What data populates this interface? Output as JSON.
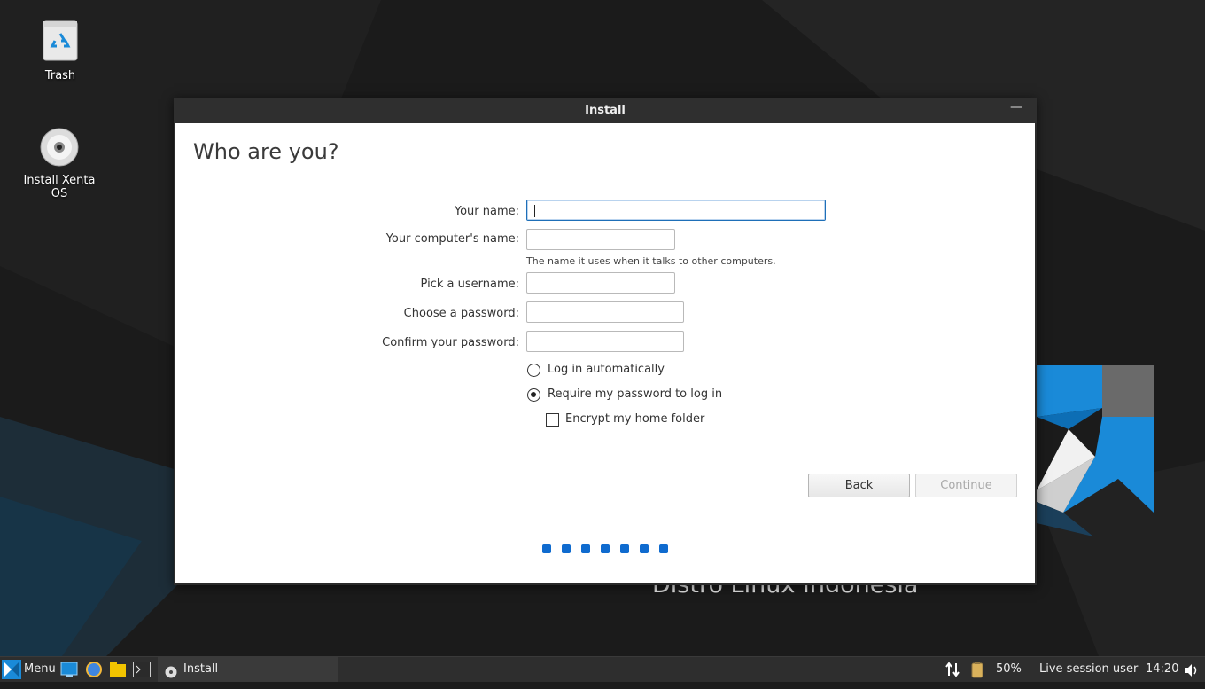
{
  "desktop": {
    "icons": [
      {
        "label": "Trash",
        "icon": "trash-icon"
      },
      {
        "label": "Install Xenta OS",
        "icon": "disc-icon"
      }
    ],
    "wallpaper_text": "Distro Linux Indonesia"
  },
  "window": {
    "title": "Install",
    "minimize_symbol": "—"
  },
  "page": {
    "title": "Who are you?",
    "fields": {
      "name": {
        "label": "Your name:",
        "value": ""
      },
      "computer": {
        "label": "Your computer's name:",
        "value": "",
        "hint": "The name it uses when it talks to other computers."
      },
      "username": {
        "label": "Pick a username:",
        "value": ""
      },
      "password": {
        "label": "Choose a password:",
        "value": ""
      },
      "confirm": {
        "label": "Confirm your password:",
        "value": ""
      }
    },
    "options": {
      "auto_login": {
        "label": "Log in automatically",
        "selected": false
      },
      "require_password": {
        "label": "Require my password to log in",
        "selected": true
      },
      "encrypt_home": {
        "label": "Encrypt my home folder",
        "checked": false
      }
    },
    "buttons": {
      "back": "Back",
      "continue": "Continue"
    },
    "progress_dots": 7
  },
  "taskbar": {
    "menu_label": "Menu",
    "launchers": [
      "desktop-icon",
      "browser-icon",
      "folder-icon",
      "terminal-icon"
    ],
    "task_label": "Install",
    "battery": "50%",
    "user": "Live session user",
    "clock": "14:20"
  },
  "colors": {
    "accent": "#0f6bcf",
    "wallpaper_blue": "#1a8ad8",
    "window_bg": "#ffffff",
    "titlebar": "#2f2f2f",
    "taskbar": "#2e2e2e"
  }
}
